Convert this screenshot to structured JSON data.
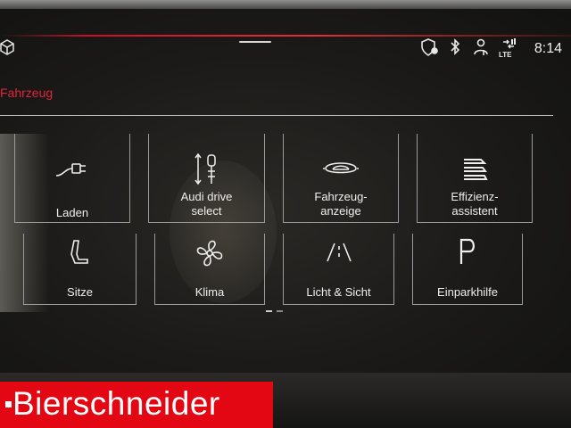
{
  "status": {
    "time": "8:14",
    "icons": [
      "cube-icon",
      "shield-location-icon",
      "bluetooth-icon",
      "user-settings-icon",
      "lte-signal-icon"
    ],
    "lte_label": "LTE"
  },
  "section": {
    "title": "Fahrzeug"
  },
  "tiles": [
    {
      "label": "Laden",
      "icon": "charging-plug-icon"
    },
    {
      "label": "Audi drive select",
      "icon": "drive-select-icon"
    },
    {
      "label": "Fahrzeug-anzeige",
      "icon": "vehicle-display-icon"
    },
    {
      "label": "Effizienz-assistent",
      "icon": "efficiency-layers-icon"
    },
    {
      "label": "Sitze",
      "icon": "seat-icon"
    },
    {
      "label": "Klima",
      "icon": "fan-icon"
    },
    {
      "label": "Licht & Sicht",
      "icon": "road-light-icon"
    },
    {
      "label": "Einparkhilfe",
      "icon": "parking-icon"
    }
  ],
  "tile_lines": {
    "t0": [
      "Laden"
    ],
    "t1": [
      "Audi drive",
      "select"
    ],
    "t2": [
      "Fahrzeug-",
      "anzeige"
    ],
    "t3": [
      "Effizienz-",
      "assistent"
    ],
    "t4": [
      "Sitze"
    ],
    "t5": [
      "Klima"
    ],
    "t6": [
      "Licht & Sicht"
    ],
    "t7": [
      "Einparkhilfe"
    ]
  },
  "pager": {
    "pages": 2,
    "current": 1
  },
  "brand": {
    "text": "Bierschneider",
    "color": "#e30613"
  },
  "colors": {
    "accent": "#e0243c",
    "text": "#eeeeee",
    "tile_border": "#9a9a9a"
  }
}
